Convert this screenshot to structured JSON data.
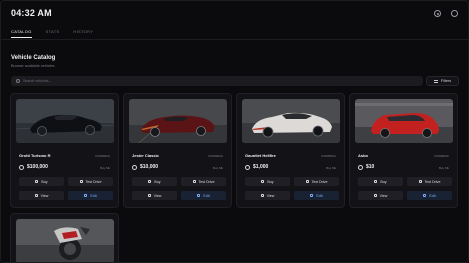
{
  "header": {
    "clock": "04:32 AM",
    "icons": [
      "settings-icon",
      "power-icon"
    ]
  },
  "tabs": [
    {
      "label": "CATALOG",
      "active": true
    },
    {
      "label": "STATS",
      "active": false
    },
    {
      "label": "HISTORY",
      "active": false
    }
  ],
  "page": {
    "title": "Vehicle Catalog",
    "subtitle": "Browse available vehicles"
  },
  "search": {
    "placeholder": "Search vehicles..."
  },
  "filters": {
    "label": "Filters"
  },
  "vehicles": [
    {
      "name": "Grotti Turismo R",
      "brand": "KOMODA",
      "price": "$100,000",
      "status": "Buy Mk",
      "buy": "Buy",
      "test": "Test Drive",
      "view": "View",
      "edit": "Edit"
    },
    {
      "name": "Jester Classic",
      "brand": "KOMODA",
      "price": "$10,000",
      "status": "Buy Mk",
      "buy": "Buy",
      "test": "Test Drive",
      "view": "View",
      "edit": "Edit"
    },
    {
      "name": "Gauntlet Hellfire",
      "brand": "KOMODA",
      "price": "$1,000",
      "status": "Buy Mk",
      "buy": "Buy",
      "test": "Test Drive",
      "view": "View",
      "edit": "Edit"
    },
    {
      "name": "Asbo",
      "brand": "KOMODA",
      "price": "$10",
      "status": "Buy Mk",
      "buy": "Buy",
      "test": "Test Drive",
      "view": "View",
      "edit": "Edit"
    }
  ],
  "colors": {
    "accent": "#7fb0ff",
    "background": "#0b0b0e",
    "card": "#131317"
  }
}
